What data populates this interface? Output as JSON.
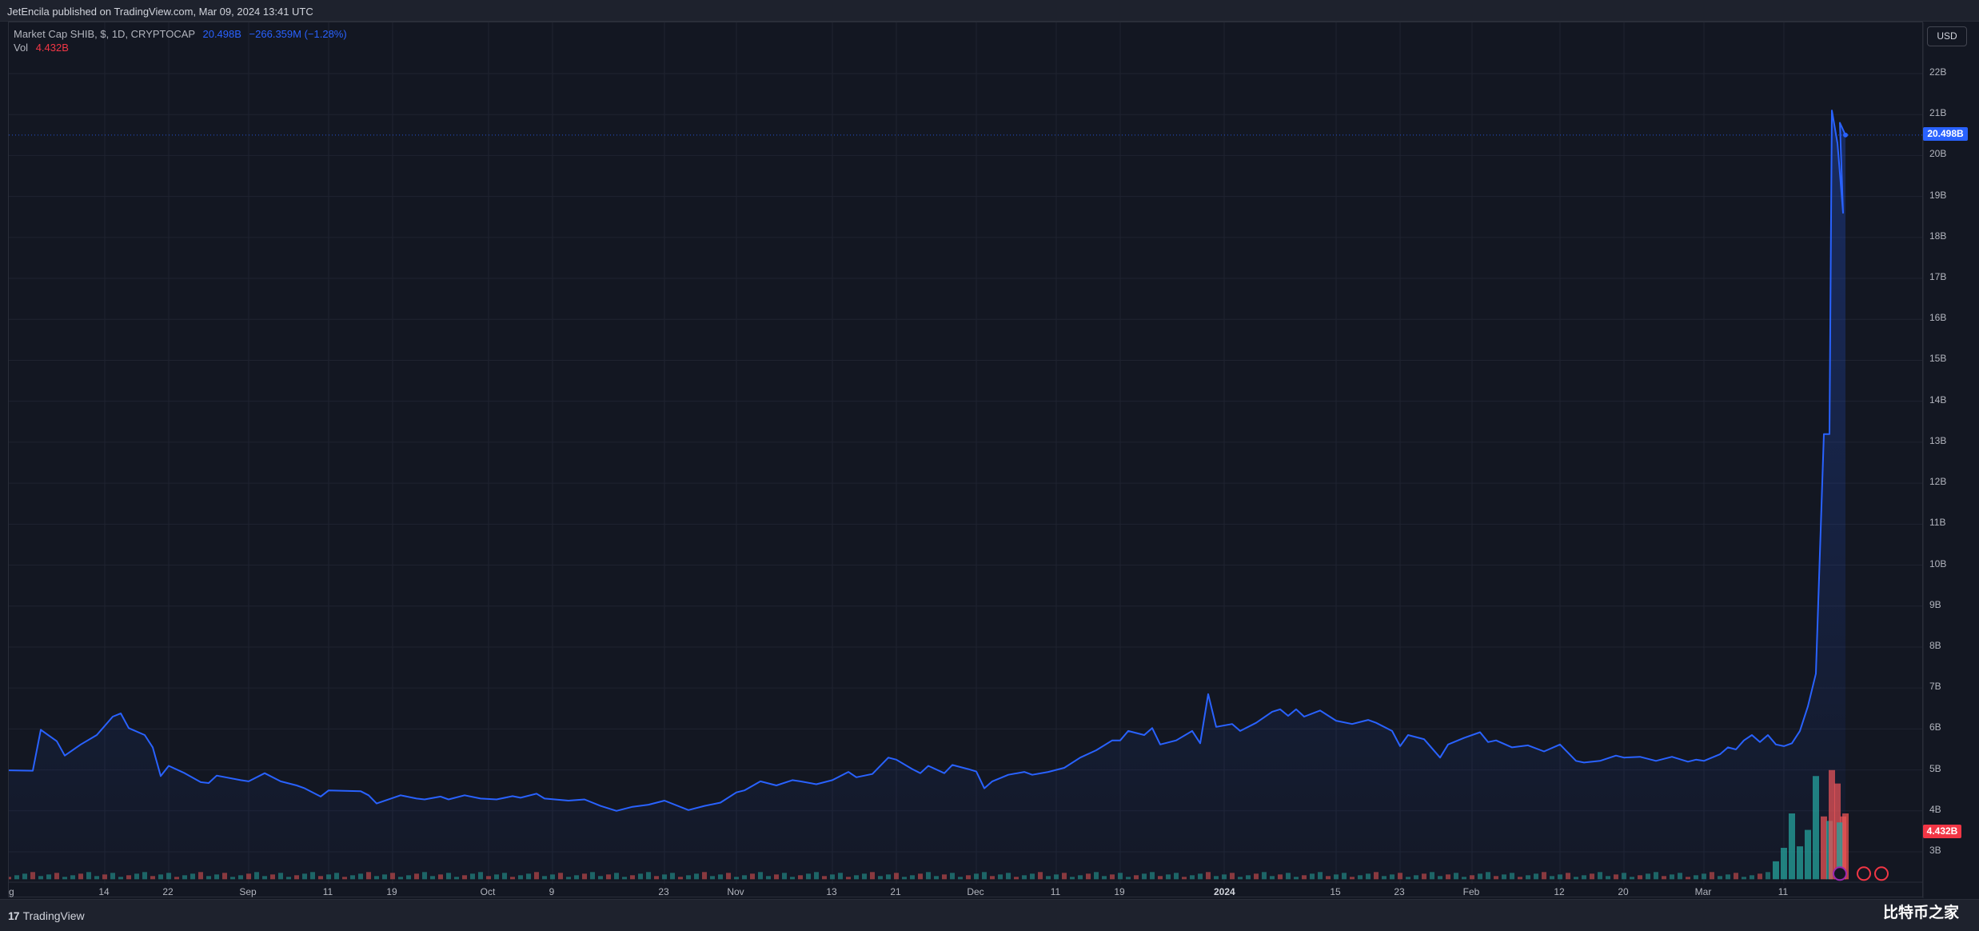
{
  "header": {
    "published_text": "JetEncila published on TradingView.com, Mar 09, 2024 13:41 UTC"
  },
  "legend": {
    "symbol": "Market Cap SHIB, $, 1D, CRYPTOCAP",
    "value": "20.498B",
    "change": "−266.359M (−1.28%)",
    "vol_label": "Vol",
    "vol_value": "4.432B"
  },
  "currency_button": "USD",
  "price_tags": {
    "last_price": "20.498B",
    "last_volume": "4.432B"
  },
  "footer": {
    "logo_mark": "17",
    "logo_text": "TradingView",
    "watermark": "比特币之家"
  },
  "colors": {
    "background": "#131722",
    "grid": "#1f2330",
    "line": "#2962ff",
    "vol_up": "#26a69a",
    "vol_down": "#ef5350",
    "axis_text": "#b2b5be"
  },
  "chart_data": {
    "type": "line",
    "title": "Market Cap SHIB, $, 1D, CRYPTOCAP",
    "y_axis": {
      "ticks": [
        "3B",
        "4B",
        "5B",
        "6B",
        "7B",
        "8B",
        "9B",
        "10B",
        "11B",
        "12B",
        "13B",
        "14B",
        "15B",
        "16B",
        "17B",
        "18B",
        "19B",
        "20B",
        "21B",
        "22B"
      ],
      "range": [
        2.3,
        23.0
      ],
      "unit": "B USD",
      "scale": "linear",
      "position": "right"
    },
    "x_axis": {
      "tick_labels": [
        {
          "label": "14",
          "date": "2023-08-14"
        },
        {
          "label": "22",
          "date": "2023-08-22"
        },
        {
          "label": "Sep",
          "date": "2023-09-01"
        },
        {
          "label": "11",
          "date": "2023-09-11"
        },
        {
          "label": "19",
          "date": "2023-09-19"
        },
        {
          "label": "Oct",
          "date": "2023-10-01"
        },
        {
          "label": "9",
          "date": "2023-10-09"
        },
        {
          "label": "23",
          "date": "2023-10-23"
        },
        {
          "label": "Nov",
          "date": "2023-11-01"
        },
        {
          "label": "13",
          "date": "2023-11-13"
        },
        {
          "label": "21",
          "date": "2023-11-21"
        },
        {
          "label": "Dec",
          "date": "2023-12-01"
        },
        {
          "label": "11",
          "date": "2023-12-11"
        },
        {
          "label": "19",
          "date": "2023-12-19"
        },
        {
          "label": "2024",
          "date": "2024-01-01"
        },
        {
          "label": "15",
          "date": "2024-01-15"
        },
        {
          "label": "23",
          "date": "2024-01-23"
        },
        {
          "label": "Feb",
          "date": "2024-02-01"
        },
        {
          "label": "12",
          "date": "2024-02-12"
        },
        {
          "label": "20",
          "date": "2024-02-20"
        },
        {
          "label": "Mar",
          "date": "2024-03-01"
        },
        {
          "label": "11",
          "date": "2024-03-11"
        }
      ],
      "left_edge_label": "g",
      "range": [
        "2023-08-02",
        "2024-03-18"
      ]
    },
    "grid": true,
    "series": [
      {
        "name": "Market Cap SHIB",
        "color": "#2962ff",
        "area_fill": true,
        "points": [
          [
            "2023-08-02",
            4.99
          ],
          [
            "2023-08-05",
            4.98
          ],
          [
            "2023-08-06",
            5.98
          ],
          [
            "2023-08-08",
            5.7
          ],
          [
            "2023-08-09",
            5.35
          ],
          [
            "2023-08-11",
            5.62
          ],
          [
            "2023-08-13",
            5.85
          ],
          [
            "2023-08-15",
            6.3
          ],
          [
            "2023-08-16",
            6.38
          ],
          [
            "2023-08-17",
            6.02
          ],
          [
            "2023-08-19",
            5.85
          ],
          [
            "2023-08-20",
            5.55
          ],
          [
            "2023-08-21",
            4.85
          ],
          [
            "2023-08-22",
            5.1
          ],
          [
            "2023-08-24",
            4.92
          ],
          [
            "2023-08-26",
            4.7
          ],
          [
            "2023-08-27",
            4.68
          ],
          [
            "2023-08-28",
            4.86
          ],
          [
            "2023-08-31",
            4.75
          ],
          [
            "2023-09-01",
            4.72
          ],
          [
            "2023-09-03",
            4.92
          ],
          [
            "2023-09-05",
            4.72
          ],
          [
            "2023-09-07",
            4.62
          ],
          [
            "2023-09-08",
            4.55
          ],
          [
            "2023-09-10",
            4.35
          ],
          [
            "2023-09-11",
            4.5
          ],
          [
            "2023-09-15",
            4.48
          ],
          [
            "2023-09-16",
            4.38
          ],
          [
            "2023-09-17",
            4.18
          ],
          [
            "2023-09-20",
            4.38
          ],
          [
            "2023-09-22",
            4.3
          ],
          [
            "2023-09-23",
            4.28
          ],
          [
            "2023-09-25",
            4.35
          ],
          [
            "2023-09-26",
            4.28
          ],
          [
            "2023-09-28",
            4.38
          ],
          [
            "2023-09-30",
            4.3
          ],
          [
            "2023-10-02",
            4.28
          ],
          [
            "2023-10-04",
            4.36
          ],
          [
            "2023-10-05",
            4.32
          ],
          [
            "2023-10-07",
            4.42
          ],
          [
            "2023-10-08",
            4.3
          ],
          [
            "2023-10-11",
            4.25
          ],
          [
            "2023-10-13",
            4.28
          ],
          [
            "2023-10-15",
            4.12
          ],
          [
            "2023-10-17",
            4.0
          ],
          [
            "2023-10-19",
            4.1
          ],
          [
            "2023-10-21",
            4.15
          ],
          [
            "2023-10-23",
            4.25
          ],
          [
            "2023-10-26",
            4.02
          ],
          [
            "2023-10-28",
            4.12
          ],
          [
            "2023-10-30",
            4.2
          ],
          [
            "2023-11-01",
            4.45
          ],
          [
            "2023-11-02",
            4.5
          ],
          [
            "2023-11-04",
            4.72
          ],
          [
            "2023-11-06",
            4.62
          ],
          [
            "2023-11-08",
            4.75
          ],
          [
            "2023-11-09",
            4.72
          ],
          [
            "2023-11-11",
            4.65
          ],
          [
            "2023-11-13",
            4.75
          ],
          [
            "2023-11-15",
            4.95
          ],
          [
            "2023-11-16",
            4.82
          ],
          [
            "2023-11-18",
            4.9
          ],
          [
            "2023-11-20",
            5.3
          ],
          [
            "2023-11-21",
            5.25
          ],
          [
            "2023-11-23",
            5.02
          ],
          [
            "2023-11-24",
            4.92
          ],
          [
            "2023-11-25",
            5.1
          ],
          [
            "2023-11-27",
            4.92
          ],
          [
            "2023-11-28",
            5.12
          ],
          [
            "2023-11-30",
            5.02
          ],
          [
            "2023-12-01",
            4.96
          ],
          [
            "2023-12-02",
            4.55
          ],
          [
            "2023-12-03",
            4.72
          ],
          [
            "2023-12-05",
            4.88
          ],
          [
            "2023-12-07",
            4.95
          ],
          [
            "2023-12-08",
            4.88
          ],
          [
            "2023-12-10",
            4.95
          ],
          [
            "2023-12-12",
            5.05
          ],
          [
            "2023-12-14",
            5.3
          ],
          [
            "2023-12-16",
            5.48
          ],
          [
            "2023-12-18",
            5.72
          ],
          [
            "2023-12-19",
            5.72
          ],
          [
            "2023-12-20",
            5.95
          ],
          [
            "2023-12-22",
            5.85
          ],
          [
            "2023-12-23",
            6.02
          ],
          [
            "2023-12-24",
            5.62
          ],
          [
            "2023-12-26",
            5.72
          ],
          [
            "2023-12-28",
            5.95
          ],
          [
            "2023-12-29",
            5.65
          ],
          [
            "2023-12-30",
            6.85
          ],
          [
            "2023-12-31",
            6.05
          ],
          [
            "2024-01-02",
            6.12
          ],
          [
            "2024-01-03",
            5.95
          ],
          [
            "2024-01-05",
            6.15
          ],
          [
            "2024-01-07",
            6.42
          ],
          [
            "2024-01-08",
            6.48
          ],
          [
            "2024-01-09",
            6.32
          ],
          [
            "2024-01-10",
            6.48
          ],
          [
            "2024-01-11",
            6.3
          ],
          [
            "2024-01-13",
            6.45
          ],
          [
            "2024-01-15",
            6.2
          ],
          [
            "2024-01-17",
            6.12
          ],
          [
            "2024-01-19",
            6.22
          ],
          [
            "2024-01-20",
            6.15
          ],
          [
            "2024-01-22",
            5.95
          ],
          [
            "2024-01-23",
            5.58
          ],
          [
            "2024-01-24",
            5.85
          ],
          [
            "2024-01-26",
            5.75
          ],
          [
            "2024-01-28",
            5.3
          ],
          [
            "2024-01-29",
            5.62
          ],
          [
            "2024-01-31",
            5.78
          ],
          [
            "2024-02-02",
            5.92
          ],
          [
            "2024-02-03",
            5.68
          ],
          [
            "2024-02-04",
            5.72
          ],
          [
            "2024-02-06",
            5.55
          ],
          [
            "2024-02-08",
            5.6
          ],
          [
            "2024-02-10",
            5.45
          ],
          [
            "2024-02-12",
            5.62
          ],
          [
            "2024-02-14",
            5.22
          ],
          [
            "2024-02-15",
            5.18
          ],
          [
            "2024-02-17",
            5.22
          ],
          [
            "2024-02-19",
            5.35
          ],
          [
            "2024-02-20",
            5.3
          ],
          [
            "2024-02-22",
            5.32
          ],
          [
            "2024-02-24",
            5.22
          ],
          [
            "2024-02-26",
            5.32
          ],
          [
            "2024-02-28",
            5.2
          ],
          [
            "2024-02-29",
            5.25
          ],
          [
            "2024-03-01",
            5.22
          ],
          [
            "2024-03-03",
            5.38
          ],
          [
            "2024-03-04",
            5.55
          ],
          [
            "2024-03-05",
            5.5
          ],
          [
            "2024-03-06",
            5.72
          ],
          [
            "2024-03-07",
            5.85
          ],
          [
            "2024-03-08",
            5.68
          ],
          [
            "2024-03-09",
            5.85
          ],
          [
            "2024-03-10",
            5.62
          ],
          [
            "2024-03-11",
            5.58
          ],
          [
            "2024-03-12",
            5.65
          ],
          [
            "2024-03-13",
            5.95
          ],
          [
            "2024-03-14",
            6.55
          ],
          [
            "2024-03-15",
            7.35
          ],
          [
            "2024-03-16",
            13.2
          ],
          [
            "2024-03-16",
            13.2
          ],
          [
            "2024-03-17",
            21.1
          ],
          [
            "2024-03-17",
            20.3
          ],
          [
            "2024-03-17",
            18.6
          ],
          [
            "2024-03-18",
            20.8
          ],
          [
            "2024-03-18",
            20.5
          ]
        ]
      }
    ],
    "volume": {
      "name": "Vol",
      "unit": "B",
      "last_value": 4.432,
      "bars": [
        {
          "date": "2024-03-10",
          "value": 1.2,
          "dir": "up"
        },
        {
          "date": "2024-03-11",
          "value": 2.1,
          "dir": "up"
        },
        {
          "date": "2024-03-12",
          "value": 4.4,
          "dir": "up"
        },
        {
          "date": "2024-03-13",
          "value": 2.2,
          "dir": "up"
        },
        {
          "date": "2024-03-14",
          "value": 3.3,
          "dir": "up"
        },
        {
          "date": "2024-03-15",
          "value": 6.9,
          "dir": "up"
        },
        {
          "date": "2024-03-16",
          "value": 4.2,
          "dir": "down"
        },
        {
          "date": "2024-03-16",
          "value": 3.9,
          "dir": "up"
        },
        {
          "date": "2024-03-17",
          "value": 7.3,
          "dir": "down"
        },
        {
          "date": "2024-03-17",
          "value": 6.4,
          "dir": "down"
        },
        {
          "date": "2024-03-17",
          "value": 4.2,
          "dir": "down"
        },
        {
          "date": "2024-03-18",
          "value": 3.8,
          "dir": "up"
        },
        {
          "date": "2024-03-18",
          "value": 4.4,
          "dir": "down"
        }
      ],
      "baseline_level": "low"
    }
  }
}
